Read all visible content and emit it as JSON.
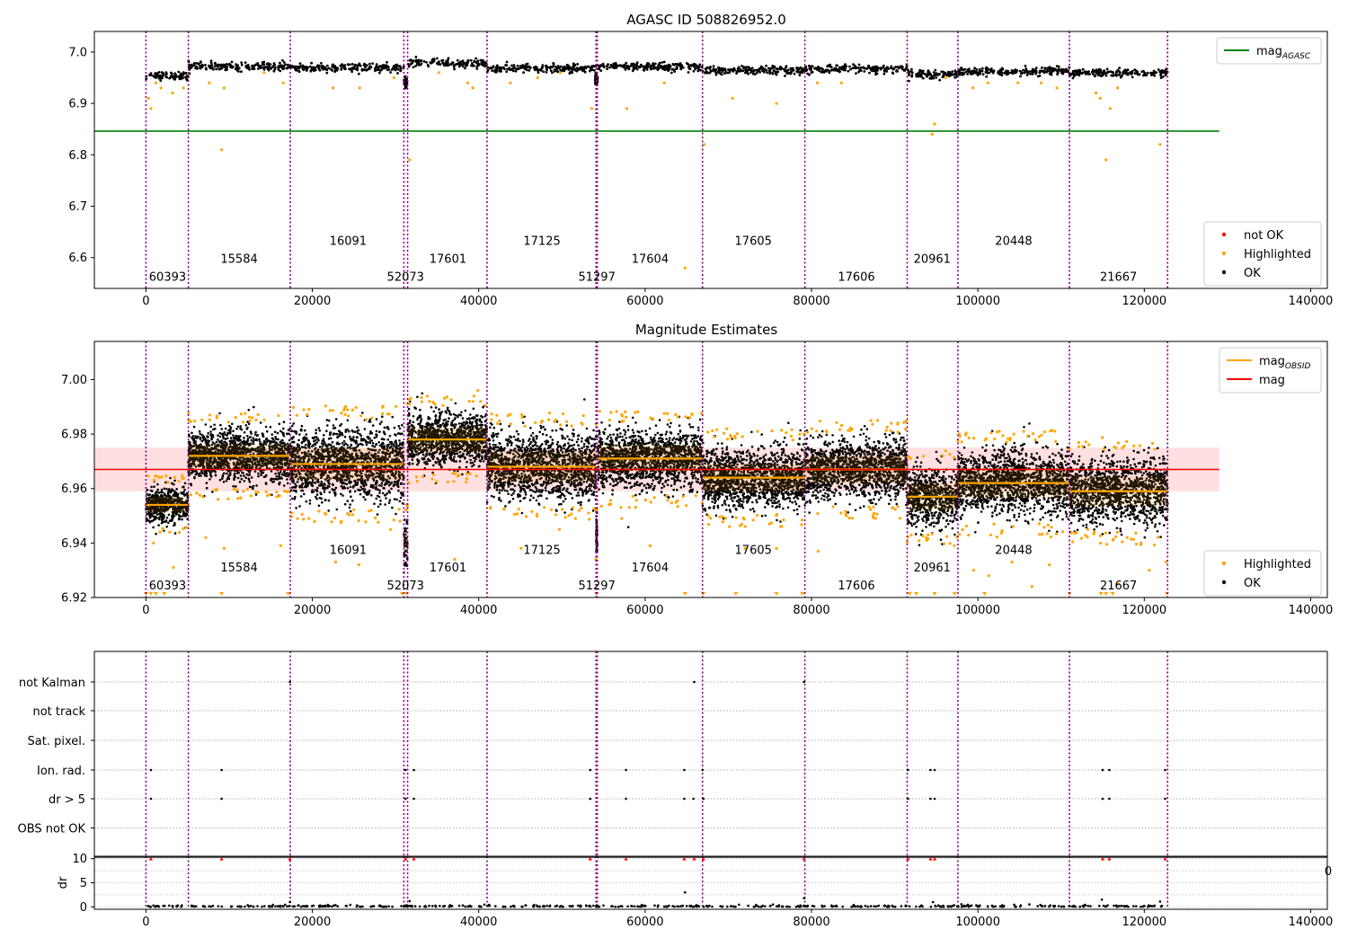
{
  "chart_data": [
    {
      "type": "scatter",
      "title": "AGASC ID 508826952.0",
      "xlabel": "",
      "ylabel": "",
      "xlim": [
        -6200,
        142000
      ],
      "ylim": [
        6.54,
        7.04
      ],
      "xticks": [
        0,
        20000,
        40000,
        60000,
        80000,
        100000,
        120000,
        140000
      ],
      "xtick_labels": [
        "0",
        "20000",
        "40000",
        "60000",
        "80000",
        "100000",
        "120000",
        "140000"
      ],
      "yticks": [
        6.6,
        6.7,
        6.8,
        6.9,
        7.0
      ],
      "ytick_labels": [
        "6.6",
        "6.7",
        "6.8",
        "6.9",
        "7.0"
      ],
      "obs_boundaries": [
        0,
        5100,
        17350,
        31000,
        31450,
        41000,
        54100,
        54250,
        66900,
        79200,
        91500,
        97600,
        111000,
        122800
      ],
      "obs_segments": [
        {
          "obsid": "60393",
          "start": 0,
          "end": 5100,
          "mean": 6.954
        },
        {
          "obsid": "15584",
          "start": 5100,
          "end": 17350,
          "mean": 6.972
        },
        {
          "obsid": "16091",
          "start": 17350,
          "end": 31000,
          "mean": 6.969
        },
        {
          "obsid": "52073",
          "start": 31000,
          "end": 31450,
          "mean": 6.94
        },
        {
          "obsid": "17601",
          "start": 31450,
          "end": 41000,
          "mean": 6.978
        },
        {
          "obsid": "17125",
          "start": 41000,
          "end": 54100,
          "mean": 6.968
        },
        {
          "obsid": "51297",
          "start": 54100,
          "end": 54250,
          "mean": 6.943
        },
        {
          "obsid": "17604",
          "start": 54250,
          "end": 66900,
          "mean": 6.971
        },
        {
          "obsid": "17605",
          "start": 66900,
          "end": 79200,
          "mean": 6.964
        },
        {
          "obsid": "17606",
          "start": 79200,
          "end": 91500,
          "mean": 6.967
        },
        {
          "obsid": "20961",
          "start": 91500,
          "end": 97600,
          "mean": 6.957
        },
        {
          "obsid": "20448",
          "start": 97600,
          "end": 111000,
          "mean": 6.962
        },
        {
          "obsid": "21667",
          "start": 111000,
          "end": 122800,
          "mean": 6.959
        }
      ],
      "obs_labels": [
        {
          "text": "60393",
          "x": 2600,
          "y": 6.555
        },
        {
          "text": "15584",
          "x": 11200,
          "y": 6.59
        },
        {
          "text": "16091",
          "x": 24300,
          "y": 6.625
        },
        {
          "text": "52073",
          "x": 31200,
          "y": 6.555
        },
        {
          "text": "17601",
          "x": 36300,
          "y": 6.59
        },
        {
          "text": "17125",
          "x": 47600,
          "y": 6.625
        },
        {
          "text": "51297",
          "x": 54200,
          "y": 6.555
        },
        {
          "text": "17604",
          "x": 60600,
          "y": 6.59
        },
        {
          "text": "17605",
          "x": 73000,
          "y": 6.625
        },
        {
          "text": "17606",
          "x": 85400,
          "y": 6.555
        },
        {
          "text": "20961",
          "x": 94500,
          "y": 6.59
        },
        {
          "text": "20448",
          "x": 104300,
          "y": 6.625
        },
        {
          "text": "21667",
          "x": 116900,
          "y": 6.555
        }
      ],
      "mag_agasc": 6.846,
      "mag_agasc_xrange": [
        -6200,
        129000
      ],
      "outliers": [
        [
          300,
          6.91
        ],
        [
          600,
          6.89
        ],
        [
          1200,
          6.94
        ],
        [
          1800,
          6.93
        ],
        [
          3200,
          6.92
        ],
        [
          4500,
          6.93
        ],
        [
          7600,
          6.94
        ],
        [
          9100,
          6.81
        ],
        [
          9400,
          6.93
        ],
        [
          14200,
          6.96
        ],
        [
          16500,
          6.94
        ],
        [
          22500,
          6.93
        ],
        [
          25700,
          6.93
        ],
        [
          29800,
          6.95
        ],
        [
          31700,
          6.79
        ],
        [
          35200,
          6.96
        ],
        [
          38700,
          6.94
        ],
        [
          39300,
          6.93
        ],
        [
          43800,
          6.94
        ],
        [
          47100,
          6.95
        ],
        [
          49800,
          6.96
        ],
        [
          53600,
          6.89
        ],
        [
          57800,
          6.89
        ],
        [
          62300,
          6.94
        ],
        [
          64800,
          6.58
        ],
        [
          67100,
          6.82
        ],
        [
          70500,
          6.91
        ],
        [
          75800,
          6.9
        ],
        [
          80700,
          6.94
        ],
        [
          83600,
          6.94
        ],
        [
          94500,
          6.84
        ],
        [
          94800,
          6.86
        ],
        [
          96100,
          6.95
        ],
        [
          99400,
          6.93
        ],
        [
          101200,
          6.94
        ],
        [
          104800,
          6.94
        ],
        [
          107600,
          6.94
        ],
        [
          109500,
          6.93
        ],
        [
          114200,
          6.92
        ],
        [
          114700,
          6.91
        ],
        [
          115400,
          6.79
        ],
        [
          115900,
          6.89
        ],
        [
          116800,
          6.93
        ],
        [
          121900,
          6.82
        ]
      ],
      "legends": [
        {
          "position": "top-right",
          "entries": [
            {
              "label": "mag",
              "sub": "AGASC",
              "color": "#008000",
              "kind": "line"
            }
          ]
        },
        {
          "position": "bottom-right",
          "entries": [
            {
              "label": "not OK",
              "color": "#ff0000",
              "kind": "dot"
            },
            {
              "label": "Highlighted",
              "color": "#ffa500",
              "kind": "dot"
            },
            {
              "label": "OK",
              "color": "#000000",
              "kind": "dot"
            }
          ]
        }
      ]
    },
    {
      "type": "scatter",
      "title": "Magnitude Estimates",
      "xlabel": "",
      "ylabel": "",
      "xlim": [
        -6200,
        142000
      ],
      "ylim": [
        6.92,
        7.014
      ],
      "xticks": [
        0,
        20000,
        40000,
        60000,
        80000,
        100000,
        120000,
        140000
      ],
      "xtick_labels": [
        "0",
        "20000",
        "40000",
        "60000",
        "80000",
        "100000",
        "120000",
        "140000"
      ],
      "yticks": [
        6.92,
        6.94,
        6.96,
        6.98,
        7.0
      ],
      "ytick_labels": [
        "6.92",
        "6.94",
        "6.96",
        "6.98",
        "7.00"
      ],
      "obs_segments": [
        {
          "obsid": "60393",
          "start": 0,
          "end": 5100,
          "mean": 6.954,
          "std": 0.003
        },
        {
          "obsid": "15584",
          "start": 5100,
          "end": 17350,
          "mean": 6.972,
          "std": 0.0045
        },
        {
          "obsid": "16091",
          "start": 17350,
          "end": 31000,
          "mean": 6.969,
          "std": 0.006
        },
        {
          "obsid": "52073",
          "start": 31000,
          "end": 31450,
          "mean": 6.94,
          "std": 0.004
        },
        {
          "obsid": "17601",
          "start": 31450,
          "end": 41000,
          "mean": 6.978,
          "std": 0.0045
        },
        {
          "obsid": "17125",
          "start": 41000,
          "end": 54100,
          "mean": 6.968,
          "std": 0.0055
        },
        {
          "obsid": "51297",
          "start": 54100,
          "end": 54250,
          "mean": 6.943,
          "std": 0.003
        },
        {
          "obsid": "17604",
          "start": 54250,
          "end": 66900,
          "mean": 6.971,
          "std": 0.005
        },
        {
          "obsid": "17605",
          "start": 66900,
          "end": 79200,
          "mean": 6.964,
          "std": 0.005
        },
        {
          "obsid": "17606",
          "start": 79200,
          "end": 91500,
          "mean": 6.967,
          "std": 0.005
        },
        {
          "obsid": "20961",
          "start": 91500,
          "end": 97600,
          "mean": 6.957,
          "std": 0.005
        },
        {
          "obsid": "20448",
          "start": 97600,
          "end": 111000,
          "mean": 6.962,
          "std": 0.0055
        },
        {
          "obsid": "21667",
          "start": 111000,
          "end": 122800,
          "mean": 6.959,
          "std": 0.0055
        }
      ],
      "obs_labels": [
        {
          "text": "60393",
          "x": 2600,
          "y": 6.923
        },
        {
          "text": "15584",
          "x": 11200,
          "y": 6.9295
        },
        {
          "text": "16091",
          "x": 24300,
          "y": 6.936
        },
        {
          "text": "52073",
          "x": 31200,
          "y": 6.923
        },
        {
          "text": "17601",
          "x": 36300,
          "y": 6.9295
        },
        {
          "text": "17125",
          "x": 47600,
          "y": 6.936
        },
        {
          "text": "51297",
          "x": 54200,
          "y": 6.923
        },
        {
          "text": "17604",
          "x": 60600,
          "y": 6.9295
        },
        {
          "text": "17605",
          "x": 73000,
          "y": 6.936
        },
        {
          "text": "17606",
          "x": 85400,
          "y": 6.923
        },
        {
          "text": "20961",
          "x": 94500,
          "y": 6.9295
        },
        {
          "text": "20448",
          "x": 104300,
          "y": 6.936
        },
        {
          "text": "21667",
          "x": 116900,
          "y": 6.923
        }
      ],
      "mag": 6.967,
      "mag_band": [
        6.959,
        6.975
      ],
      "mag_xrange": [
        -6200,
        129000
      ],
      "clipped_markers_x": [
        0,
        600,
        1200,
        2200,
        9100,
        17100,
        30800,
        31300,
        54150,
        64800,
        67000,
        70900,
        75800,
        78900,
        91800,
        92600,
        94800,
        97200,
        100800,
        111000,
        114800,
        115400,
        116200,
        122700
      ],
      "outliers": [
        [
          900,
          6.94
        ],
        [
          1700,
          6.944
        ],
        [
          3300,
          6.931
        ],
        [
          7200,
          6.942
        ],
        [
          9400,
          6.938
        ],
        [
          16200,
          6.939
        ],
        [
          22800,
          6.933
        ],
        [
          25600,
          6.932
        ],
        [
          29400,
          6.945
        ],
        [
          37100,
          6.934
        ],
        [
          39900,
          6.996
        ],
        [
          45100,
          6.938
        ],
        [
          49700,
          6.945
        ],
        [
          53200,
          6.951
        ],
        [
          57200,
          6.949
        ],
        [
          60600,
          6.939
        ],
        [
          72000,
          6.938
        ],
        [
          75800,
          6.938
        ],
        [
          80800,
          6.937
        ],
        [
          87400,
          6.95
        ],
        [
          99500,
          6.93
        ],
        [
          101300,
          6.928
        ],
        [
          104100,
          6.933
        ],
        [
          106500,
          6.924
        ],
        [
          108600,
          6.932
        ],
        [
          113200,
          6.945
        ],
        [
          116900,
          6.925
        ],
        [
          120600,
          6.93
        ],
        [
          122600,
          6.933
        ]
      ],
      "legends": [
        {
          "position": "top-right",
          "entries": [
            {
              "label": "mag",
              "sub": "OBSID",
              "color": "#ffa500",
              "kind": "line"
            },
            {
              "label": "mag",
              "color": "#ff0000",
              "kind": "line"
            }
          ]
        },
        {
          "position": "bottom-right",
          "entries": [
            {
              "label": "Highlighted",
              "color": "#ffa500",
              "kind": "dot"
            },
            {
              "label": "OK",
              "color": "#000000",
              "kind": "dot"
            }
          ]
        }
      ]
    },
    {
      "type": "scatter",
      "title": "",
      "xlabel": "",
      "ylabel": "",
      "xlim": [
        -6200,
        142000
      ],
      "categories": [
        "OBS not OK",
        "dr > 5",
        "Ion. rad.",
        "Sat. pixel.",
        "not track",
        "not Kalman"
      ],
      "flag_points": {
        "not Kalman": [
          17300,
          65900,
          79100
        ],
        "dr > 5": [
          600,
          9100,
          31200,
          32200,
          53400,
          57700,
          64700,
          65800,
          67000,
          91600,
          94300,
          94800,
          115000,
          115800,
          122500
        ],
        "Ion. rad.": [
          600,
          9100,
          31200,
          32200,
          53400,
          57700,
          64700,
          66900,
          91600,
          94300,
          94800,
          115000,
          115800,
          122500
        ]
      }
    },
    {
      "type": "scatter",
      "title": "",
      "xlabel": "",
      "ylabel": "dr",
      "xlim": [
        -6200,
        142000
      ],
      "ylim": [
        -0.5,
        10.5
      ],
      "xticks": [
        0,
        20000,
        40000,
        60000,
        80000,
        100000,
        120000,
        140000
      ],
      "xtick_labels": [
        "0",
        "20000",
        "40000",
        "60000",
        "80000",
        "100000",
        "120000",
        "140000"
      ],
      "yticks": [
        0,
        5,
        10
      ],
      "ytick_labels": [
        "0",
        "5",
        "10"
      ],
      "clipped_markers_x": [
        600,
        9100,
        17300,
        31200,
        32200,
        53400,
        57700,
        64700,
        65900,
        67000,
        79100,
        91600,
        94300,
        94800,
        115000,
        115800,
        122500
      ],
      "outliers": [
        [
          31700,
          1.2
        ],
        [
          64800,
          3.0
        ],
        [
          94600,
          1.0
        ],
        [
          114900,
          1.5
        ],
        [
          121900,
          1.1
        ],
        [
          17300,
          1.0
        ],
        [
          79100,
          1.8
        ]
      ],
      "stray_label": "0"
    }
  ]
}
